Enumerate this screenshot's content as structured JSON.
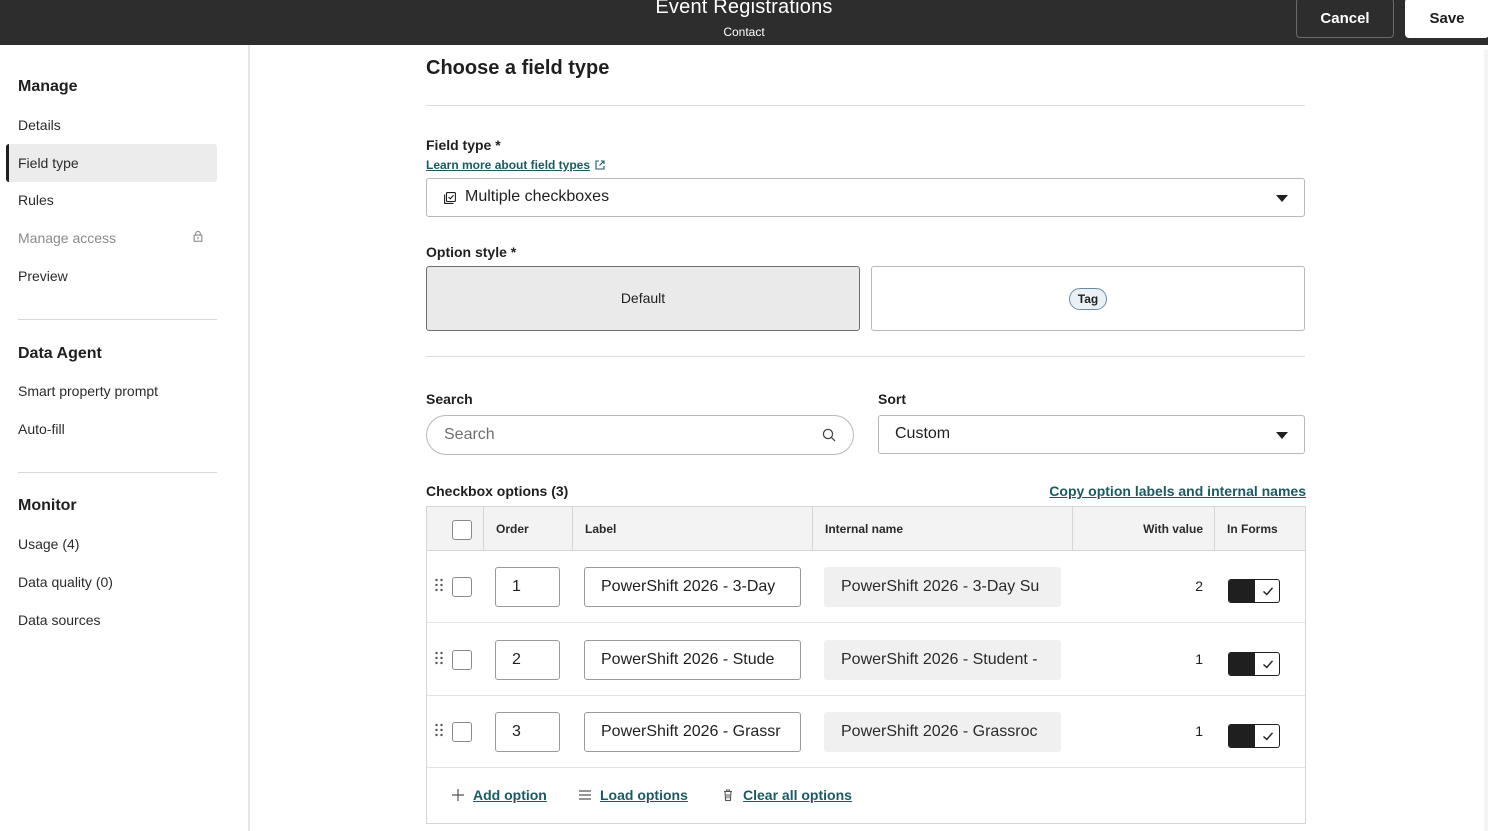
{
  "header": {
    "title": "Event Registrations",
    "subtitle": "Contact",
    "cancel_label": "Cancel",
    "save_label": "Save"
  },
  "sidebar": {
    "sections": [
      {
        "heading": "Manage",
        "items": [
          "Details",
          "Field type",
          "Rules",
          "Manage access",
          "Preview"
        ]
      },
      {
        "heading": "Data Agent",
        "items": [
          "Smart property prompt",
          "Auto-fill"
        ]
      },
      {
        "heading": "Monitor",
        "items": [
          "Usage (4)",
          "Data quality (0)",
          "Data sources"
        ]
      }
    ],
    "active_item": "Field type"
  },
  "main": {
    "title": "Choose a field type",
    "field_type": {
      "label": "Field type *",
      "learn_more": "Learn more about field types",
      "value": "Multiple checkboxes"
    },
    "option_style": {
      "label": "Option style *",
      "options": [
        "Default",
        "Tag"
      ],
      "selected": "Default"
    },
    "search": {
      "label": "Search",
      "placeholder": "Search"
    },
    "sort": {
      "label": "Sort",
      "value": "Custom"
    },
    "checkbox_options": {
      "title": "Checkbox options (3)",
      "copy_link": "Copy option labels and internal names",
      "columns": [
        "Order",
        "Label",
        "Internal name",
        "With value",
        "In Forms"
      ],
      "rows": [
        {
          "order": "1",
          "label": "PowerShift 2026 - 3-Day",
          "internal": "PowerShift 2026 - 3-Day Su",
          "with_value": "2"
        },
        {
          "order": "2",
          "label": "PowerShift 2026 - Stude",
          "internal": "PowerShift 2026 - Student -",
          "with_value": "1"
        },
        {
          "order": "3",
          "label": "PowerShift 2026 - Grassr",
          "internal": "PowerShift 2026 - Grassroc",
          "with_value": "1"
        }
      ],
      "footer": {
        "add": "Add option",
        "load": "Load options",
        "clear": "Clear all options"
      }
    }
  },
  "colors": {
    "header_bg": "#2d2d2d",
    "link": "#1c5a63",
    "selected_card": "#eaeaea"
  }
}
